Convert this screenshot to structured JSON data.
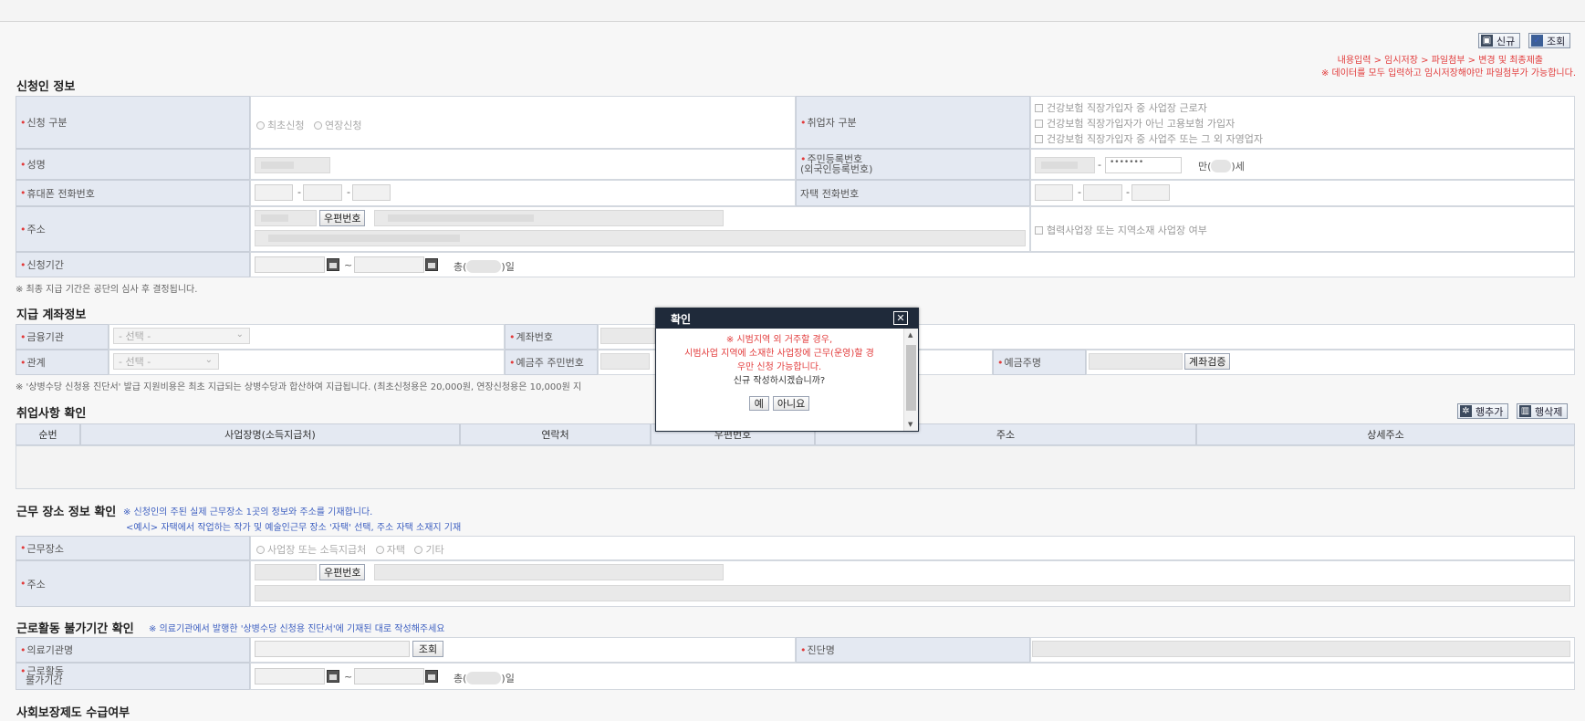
{
  "toolbar": {
    "new_label": "신규",
    "search_label": "조회"
  },
  "notice": {
    "steps": "내용입력 > 임시저장 > 파일첨부 > 변경 및 최종제출",
    "warning": "※ 데이터를 모두 입력하고 임시저장해야만 파일첨부가 가능합니다."
  },
  "applicant": {
    "title": "신청인 정보",
    "apply_type_label": "신청 구분",
    "apply_type_options": [
      "최초신청",
      "연장신청"
    ],
    "worker_type_label": "취업자 구분",
    "worker_type_options": [
      "건강보험 직장가입자 중 사업장 근로자",
      "건강보험 직장가입자가 아닌 고용보험 가입자",
      "건강보험 직장가입자 중 사업주 또는 그 외 자영업자"
    ],
    "name_label": "성명",
    "rrn_label_1": "주민등록번호",
    "rrn_label_2": "(외국인등록번호)",
    "rrn_mask": "•••••••",
    "age_prefix": "만(",
    "age_suffix": ")세",
    "mobile_label": "휴대폰 전화번호",
    "home_phone_label": "자택 전화번호",
    "address_label": "주소",
    "zip_button": "우편번호",
    "partner_label": "협력사업장 또는 지역소재 사업장 여부",
    "period_label": "신청기간",
    "total_prefix": "총(",
    "total_suffix": ")일",
    "note": "※ 최종 지급 기간은 공단의 심사 후 결정됩니다."
  },
  "account": {
    "title": "지급 계좌정보",
    "bank_label": "금융기관",
    "bank_placeholder": "- 선택 -",
    "account_no_label": "계좌번호",
    "relation_label": "관계",
    "relation_placeholder": "- 선택 -",
    "holder_rrn_label": "예금주 주민번호",
    "holder_name_label": "예금주명",
    "verify_button": "계좌검증",
    "note": "※ '상병수당 신청용 진단서' 발급 지원비용은 최초 지급되는 상병수당과 합산하여 지급됩니다. (최초신청용은 20,000원, 연장신청용은 10,000원 지"
  },
  "employment": {
    "title": "취업사항 확인",
    "add_row": "행추가",
    "del_row": "행삭제",
    "columns": [
      "순번",
      "사업장명(소득지급처)",
      "연락처",
      "우편번호",
      "주소",
      "상세주소"
    ]
  },
  "workplace": {
    "title": "근무 장소 정보 확인",
    "note1": "※ 신청인의 주된 실제 근무장소 1곳의 정보와 주소를 기재합니다.",
    "note2": "<예시> 자택에서 작업하는 작가 및 예술인근무 장소 '자택' 선택, 주소 자택 소재지 기재",
    "place_label": "근무장소",
    "place_options": [
      "사업장 또는 소득지급처",
      "자택",
      "기타"
    ],
    "address_label": "주소",
    "zip_button": "우편번호"
  },
  "incapacity": {
    "title": "근로활동 불가기간 확인",
    "note": "※ 의료기관에서 발행한 '상병수당 신청용 진단서'에 기재된 대로 작성해주세요",
    "hospital_label": "의료기관명",
    "search_button": "조회",
    "diagnosis_label": "진단명",
    "period_label_1": "근로활동",
    "period_label_2": "불가기간",
    "total_prefix": "총(",
    "total_suffix": ")일"
  },
  "social": {
    "title": "사회보장제도 수급여부"
  },
  "dialog": {
    "title": "확인",
    "line1": "※ 시범지역 외 거주할 경우,",
    "line2": "시범사업 지역에 소재한 사업장에 근무(운영)할 경",
    "line3": "우만 신청 가능합니다.",
    "line4": "신규 작성하시겠습니까?",
    "yes": "예",
    "no": "아니요"
  }
}
